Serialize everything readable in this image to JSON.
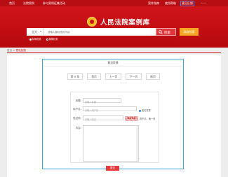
{
  "topbar": {
    "left_links": [
      "首页",
      "法院案例",
      "参与案例征集活动"
    ],
    "right_links": [
      "案件指南",
      "使用帮助",
      "意见反馈"
    ],
    "active_link": "意见反馈",
    "user": "——"
  },
  "header": {
    "title": "人民法院案例库"
  },
  "search": {
    "scope_label": "全文",
    "placeholder": "请输入要检索的内容",
    "button_label": "检索",
    "advanced_label": "高级检索",
    "options": [
      {
        "label": "精确检索",
        "selected": true
      },
      {
        "label": "模糊检索",
        "selected": false
      }
    ]
  },
  "breadcrumb": {
    "home": "首页",
    "current": "意见反馈"
  },
  "panel": {
    "title": "意见反馈",
    "pager": [
      "第 0 条",
      "首页",
      "上一页",
      "下一页",
      "尾页"
    ]
  },
  "form": {
    "title_label": "标题:",
    "title_placeholder": "请输入标题",
    "user_label": "用户名:",
    "user_placeholder": "请输入用户名",
    "anonymous_label": "匿名发表",
    "captcha_label": "验证码:",
    "captcha_placeholder": "请输入验证",
    "captcha_text": "8X9A",
    "captcha_hint": "看不清，换一张",
    "content_label": "内容:",
    "submit_label": "提交"
  },
  "colors": {
    "brand_red": "#c10d12",
    "accent_orange": "#f5a623",
    "outline_blue": "#3aa4d8"
  }
}
